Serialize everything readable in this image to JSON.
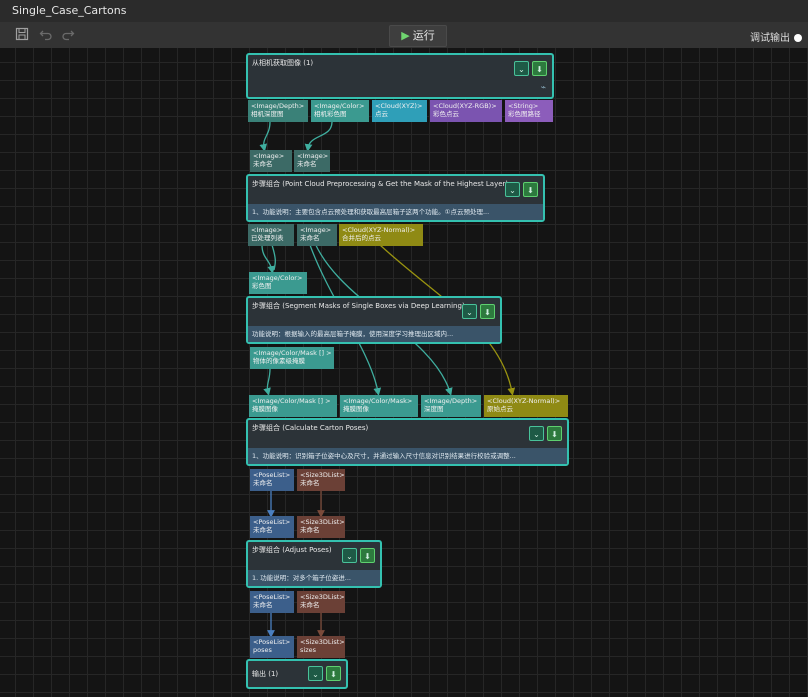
{
  "window": {
    "title": "Single_Case_Cartons"
  },
  "toolbar": {
    "save_icon": "save-icon",
    "undo_icon": "undo-icon",
    "redo_icon": "redo-icon",
    "run_label": "运行",
    "debug_label": "调试输出"
  },
  "nodes": {
    "capture": {
      "title": "从相机获取图像 (1)"
    },
    "step1": {
      "title": "步骤组合 (Point Cloud Preprocessing & Get the Mask of the Highest Layer)",
      "desc": "1、功能说明：主要包含点云预处理和获取最高层箱子这两个功能。①点云预处理..."
    },
    "step2": {
      "title": "步骤组合 (Segment Masks of Single Boxes via Deep Learning)",
      "desc": "功能说明：根据输入的最高层箱子掩膜，使用深度学习推理出区域内..."
    },
    "step3": {
      "title": "步骤组合 (Calculate Carton Poses)",
      "desc": "1、功能说明：识别箱子位姿中心及尺寸，并通过输入尺寸信息对识别结果进行校验或调整..."
    },
    "step4": {
      "title": "步骤组合 (Adjust Poses)",
      "desc": "1. 功能说明：对多个箱子位姿进..."
    },
    "output": {
      "title": "输出 (1)"
    }
  },
  "ports": {
    "cap_out": [
      {
        "type": "<Image/Depth>",
        "name": "相机深度图"
      },
      {
        "type": "<Image/Color>",
        "name": "相机彩色图"
      },
      {
        "type": "<Cloud(XYZ)>",
        "name": "点云"
      },
      {
        "type": "<Cloud(XYZ-RGB)>",
        "name": "彩色点云"
      },
      {
        "type": "<String>",
        "name": "彩色图路径"
      }
    ],
    "s1_in": [
      {
        "type": "<Image>",
        "name": "未命名"
      },
      {
        "type": "<Image>",
        "name": "未命名"
      }
    ],
    "s1_out": [
      {
        "type": "<Image>",
        "name": "已处理列表"
      },
      {
        "type": "<Image>",
        "name": "未命名"
      },
      {
        "type": "<Cloud(XYZ-Normal)>",
        "name": "合并后的点云"
      }
    ],
    "s2_in": [
      {
        "type": "<Image/Color>",
        "name": "彩色图"
      }
    ],
    "s2_out": [
      {
        "type": "<Image/Color/Mask [] >",
        "name": "物体的像素级掩膜"
      }
    ],
    "s3_in": [
      {
        "type": "<Image/Color/Mask [] >",
        "name": "掩膜图像"
      },
      {
        "type": "<Image/Color/Mask>",
        "name": "掩膜图像"
      },
      {
        "type": "<Image/Depth>",
        "name": "深度图"
      },
      {
        "type": "<Cloud(XYZ-Normal)>",
        "name": "原始点云"
      }
    ],
    "s3_out": [
      {
        "type": "<PoseList>",
        "name": "未命名"
      },
      {
        "type": "<Size3DList>",
        "name": "未命名"
      }
    ],
    "s4_in": [
      {
        "type": "<PoseList>",
        "name": "未命名"
      },
      {
        "type": "<Size3DList>",
        "name": "未命名"
      }
    ],
    "s4_out": [
      {
        "type": "<PoseList>",
        "name": "未命名"
      },
      {
        "type": "<Size3DList>",
        "name": "未命名"
      }
    ],
    "out_in": [
      {
        "type": "<PoseList>",
        "name": "poses"
      },
      {
        "type": "<Size3DList>",
        "name": "sizes"
      }
    ]
  },
  "colors": {
    "node_border": "#34c1b0",
    "wire_teal": "#3fae9f",
    "wire_olive": "#9a9410",
    "wire_blue": "#4a7fc0",
    "wire_brown": "#7a4a3a"
  }
}
